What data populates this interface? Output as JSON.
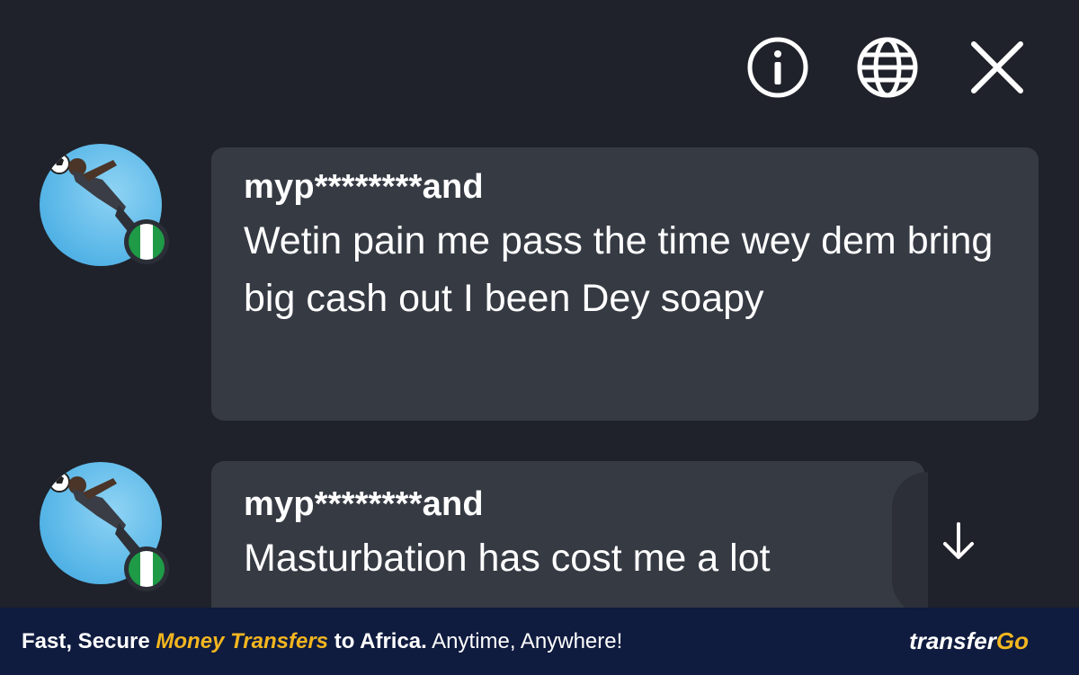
{
  "toolbar": {
    "info_icon": "info-icon",
    "language_icon": "globe-icon",
    "close_icon": "close-icon"
  },
  "messages": [
    {
      "username": "myp********and",
      "text": "Wetin pain me pass the time wey dem bring big cash out I been Dey soapy",
      "flag": "nigeria-flag"
    },
    {
      "username": "myp********and",
      "text": "Masturbation has cost me a lot",
      "flag": "nigeria-flag"
    }
  ],
  "scroll_icon": "arrow-down-icon",
  "ad": {
    "part1": "Fast, Secure ",
    "highlight": "Money Transfers",
    "part2": " to Africa.",
    "part3": " Anytime, Anywhere!",
    "logo_main": "transfer",
    "logo_accent": "Go"
  },
  "colors": {
    "background": "#1f222a",
    "bubble": "#363a43",
    "ad_background": "#0f1b3f",
    "accent": "#f3b61f"
  }
}
